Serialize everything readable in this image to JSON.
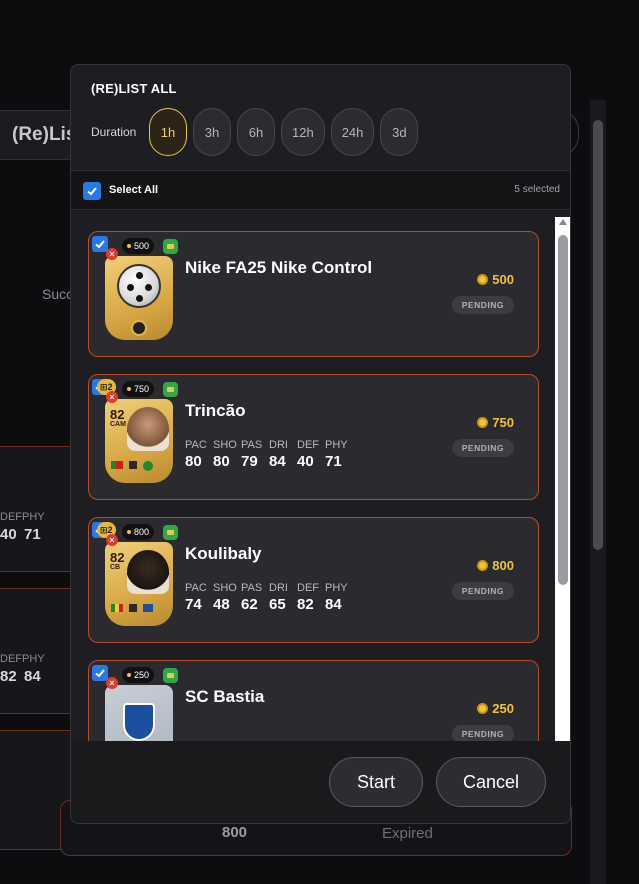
{
  "background": {
    "tab_label": "(Re)Lis",
    "succ_label": "Succ",
    "rows": [
      {
        "stat1_label": "DEF",
        "stat2_label": "PHY",
        "stat1_value": "40",
        "stat2_value": "71"
      },
      {
        "stat1_label": "DEF",
        "stat2_label": "PHY",
        "stat1_value": "82",
        "stat2_value": "84"
      }
    ],
    "bottom_price": "800",
    "bottom_status": "Expired"
  },
  "modal": {
    "title": "(RE)LIST ALL",
    "duration_label": "Duration",
    "durations": [
      "1h",
      "3h",
      "6h",
      "12h",
      "24h",
      "3d"
    ],
    "active_duration": "1h",
    "select_all_label": "Select All",
    "selected_count": "5 selected",
    "items": [
      {
        "name": "Nike FA25 Nike Control",
        "price": "500",
        "badge_price": "500",
        "status": "PENDING",
        "card": "ball"
      },
      {
        "name": "Trincão",
        "price": "750",
        "badge_price": "750",
        "status": "PENDING",
        "rating": "82",
        "position": "CAM",
        "badge": "2",
        "stats": [
          {
            "l": "PAC",
            "v": "80"
          },
          {
            "l": "SHO",
            "v": "80"
          },
          {
            "l": "PAS",
            "v": "79"
          },
          {
            "l": "DRI",
            "v": "84"
          },
          {
            "l": "DEF",
            "v": "40"
          },
          {
            "l": "PHY",
            "v": "71"
          }
        ]
      },
      {
        "name": "Koulibaly",
        "price": "800",
        "badge_price": "800",
        "status": "PENDING",
        "rating": "82",
        "position": "CB",
        "badge": "2",
        "stats": [
          {
            "l": "PAC",
            "v": "74"
          },
          {
            "l": "SHO",
            "v": "48"
          },
          {
            "l": "PAS",
            "v": "62"
          },
          {
            "l": "DRI",
            "v": "65"
          },
          {
            "l": "DEF",
            "v": "82"
          },
          {
            "l": "PHY",
            "v": "84"
          }
        ]
      },
      {
        "name": "SC Bastia",
        "price": "250",
        "badge_price": "250",
        "status": "PENDING",
        "card": "crest"
      }
    ],
    "start_label": "Start",
    "cancel_label": "Cancel"
  },
  "colors": {
    "accent_gold": "#f3c13a",
    "check_blue": "#2878e8",
    "border_orange": "#b84a2c"
  }
}
